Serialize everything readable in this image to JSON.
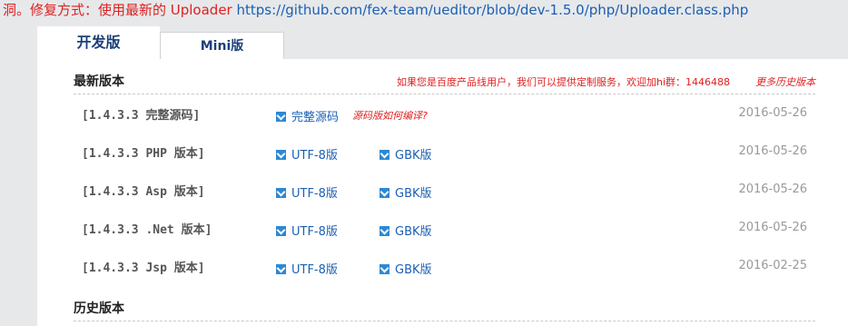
{
  "notice": {
    "text": "洞。修复方式：使用最新的 Uploader",
    "link": "https://github.com/fex-team/ueditor/blob/dev-1.5.0/php/Uploader.class.php"
  },
  "tabs": [
    {
      "label": "开发版",
      "active": true
    },
    {
      "label": "Mini版",
      "active": false
    }
  ],
  "latest": {
    "title": "最新版本",
    "promo": "如果您是百度产品线用户，我们可以提供定制服务，欢迎加hi群：1446488",
    "more": "更多历史版本",
    "rows": [
      {
        "name": "[1.4.3.3 完整源码]",
        "link1": "完整源码",
        "extra": "源码版如何编译?",
        "link2": "",
        "date": "2016-05-26"
      },
      {
        "name": "[1.4.3.3 PHP 版本]",
        "link1": "UTF-8版",
        "extra": "",
        "link2": "GBK版",
        "date": "2016-05-26"
      },
      {
        "name": "[1.4.3.3 Asp 版本]",
        "link1": "UTF-8版",
        "extra": "",
        "link2": "GBK版",
        "date": "2016-05-26"
      },
      {
        "name": "[1.4.3.3 .Net 版本]",
        "link1": "UTF-8版",
        "extra": "",
        "link2": "GBK版",
        "date": "2016-05-26"
      },
      {
        "name": "[1.4.3.3 Jsp 版本]",
        "link1": "UTF-8版",
        "extra": "",
        "link2": "GBK版",
        "date": "2016-02-25"
      }
    ]
  },
  "history": {
    "title": "历史版本"
  },
  "colors": {
    "accent_red": "#e02020",
    "link_blue": "#1a5fb4",
    "tab_blue": "#1c3f7a"
  }
}
